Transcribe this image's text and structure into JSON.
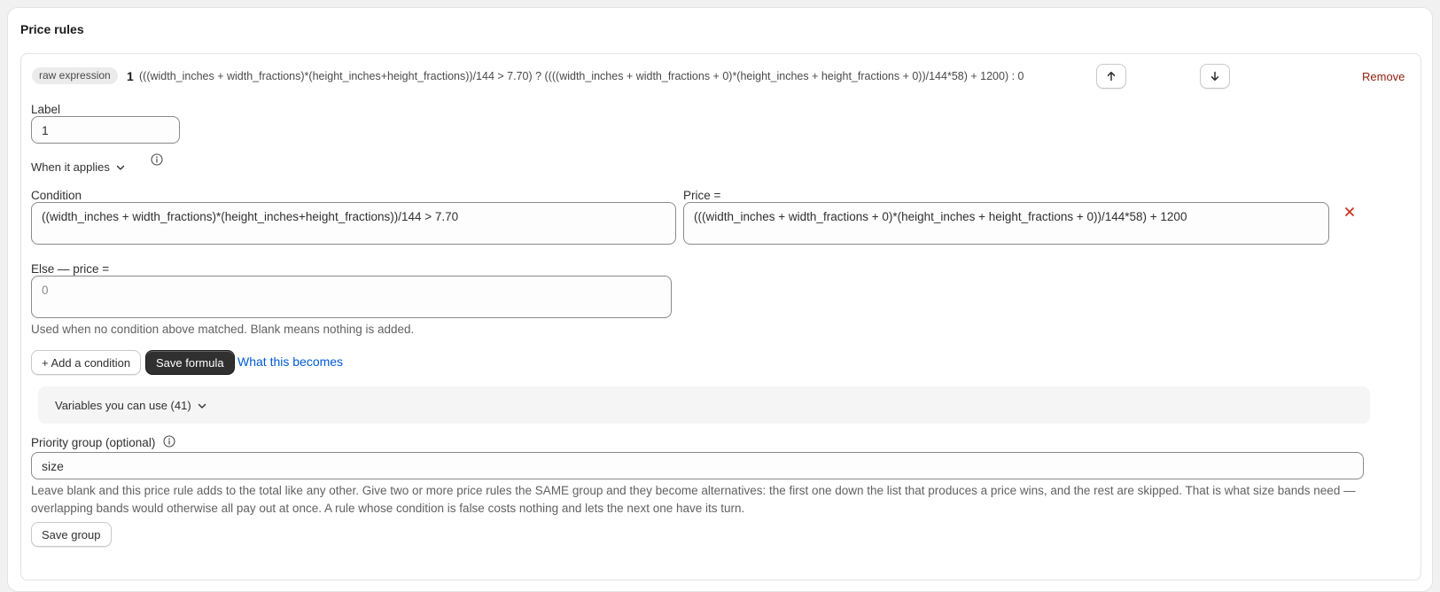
{
  "card": {
    "title": "Price rules"
  },
  "rule": {
    "badge": "raw expression",
    "number": "1",
    "expression": "(((width_inches + width_fractions)*(height_inches+height_fractions))/144 > 7.70) ? ((((width_inches + width_fractions + 0)*(height_inches + height_fractions + 0))/144*58) + 1200) : 0",
    "move_up_icon": "arrow-up-icon",
    "move_down_icon": "arrow-down-icon",
    "remove_label": "Remove",
    "label_field": {
      "label": "Label",
      "value": "1"
    },
    "when_applies": "When it applies",
    "condition": {
      "label": "Condition",
      "value": "((width_inches + width_fractions)*(height_inches+height_fractions))/144 > 7.70"
    },
    "price": {
      "label": "Price =",
      "value": "(((width_inches + width_fractions + 0)*(height_inches + height_fractions + 0))/144*58) + 1200"
    },
    "else_price": {
      "label": "Else — price =",
      "value": "0"
    },
    "else_help": "Used when no condition above matched. Blank means nothing is added.",
    "add_condition_label": "+ Add a condition",
    "save_formula_label": "Save formula",
    "what_becomes_label": "What this becomes",
    "variables_label": "Variables you can use (41)",
    "priority": {
      "label": "Priority group (optional)",
      "value": "size",
      "help": "Leave blank and this price rule adds to the total like any other. Give two or more price rules the SAME group and they become alternatives: the first one down the list that produces a price wins, and the rest are skipped. That is what size bands need — overlapping bands would otherwise all pay out at once. A rule whose condition is false costs nothing and lets the next one have its turn.",
      "save_label": "Save group"
    }
  },
  "colors": {
    "remove": "#8e1f0b",
    "link": "#005bd3",
    "primary_button": "#303030",
    "delete_x": "#c5280c"
  }
}
